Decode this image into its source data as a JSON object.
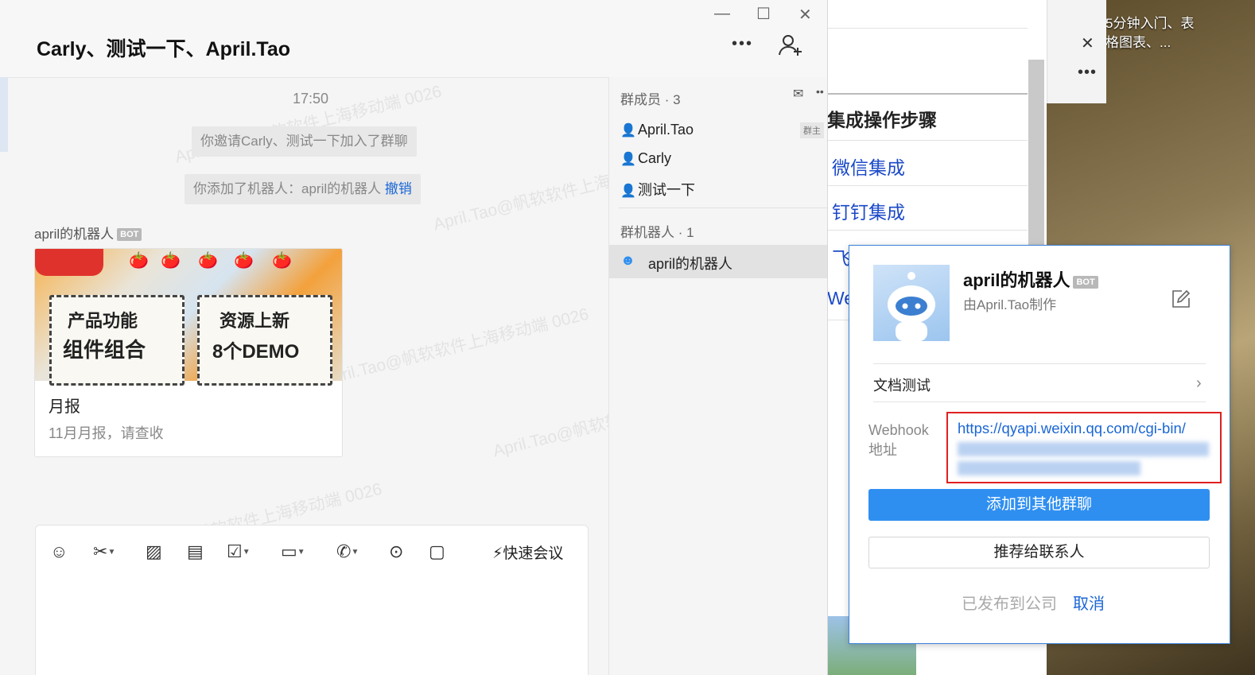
{
  "chat": {
    "title": "Carly、测试一下、April.Tao",
    "time": "17:50",
    "system_invite": "你邀请Carly、测试一下加入了群聊",
    "system_added": "你添加了机器人：april的机器人",
    "system_undo": "撤销",
    "sender": "april的机器人",
    "bot_badge": "BOT",
    "card_title": "月报",
    "card_subtitle": "11月月报，请查收",
    "card_image_text_1a": "产品功能",
    "card_image_text_1b": "组件组合",
    "card_image_text_2a": "资源上新",
    "card_image_text_2b": "8个DEMO",
    "watermark": "April.Tao@帆软软件上海移动端 0026"
  },
  "toolbar": {
    "quick_meeting": "快速会议"
  },
  "members_panel": {
    "members_header": "群成员 · 3",
    "owner_tag": "群主",
    "members": [
      "April.Tao",
      "Carly",
      "测试一下"
    ],
    "bots_header": "群机器人 · 1",
    "bots": [
      "april的机器人"
    ]
  },
  "docs_window": {
    "heading": "集成操作步骤",
    "links": [
      "微信集成",
      "钉钉集成",
      "飞",
      "We"
    ]
  },
  "desktop": {
    "icon_label": "5分钟入门、表格图表、..."
  },
  "popup": {
    "name": "april的机器人",
    "badge": "BOT",
    "maker": "由April.Tao制作",
    "doc_test": "文档测试",
    "webhook_label": "Webhook 地址",
    "webhook_url": "https://qyapi.weixin.qq.com/cgi-bin/",
    "add_to_group": "添加到其他群聊",
    "recommend": "推荐给联系人",
    "published": "已发布到公司",
    "cancel": "取消"
  },
  "colors": {
    "accent": "#2f8ff0",
    "link": "#1a66d6",
    "highlight_border": "#e02020"
  }
}
